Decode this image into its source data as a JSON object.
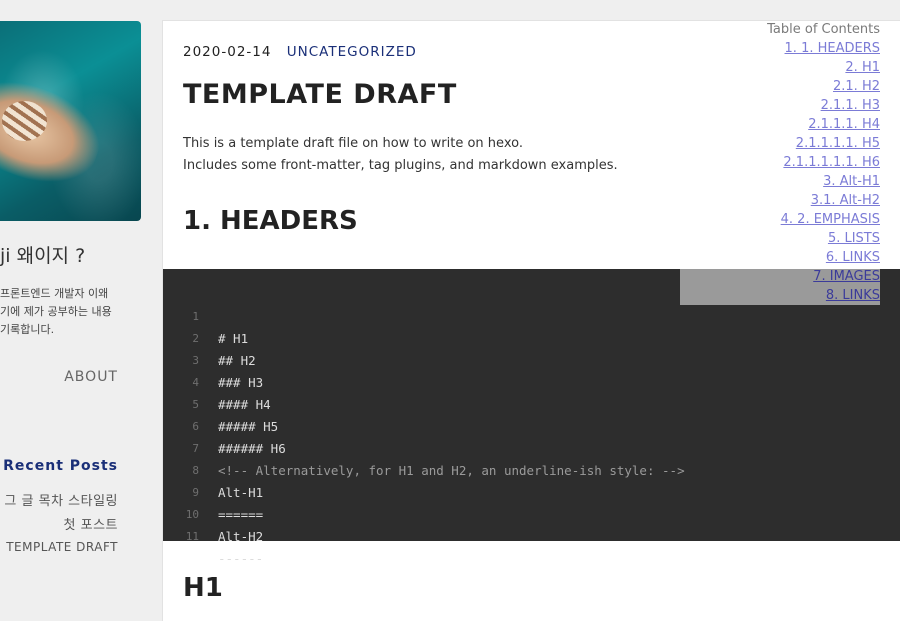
{
  "sidebar": {
    "site_title": "ji 왜이지 ?",
    "description": "프론트엔드 개발자 이왜 기에 제가 공부하는 내용 기록합니다.",
    "nav": {
      "about": "ABOUT"
    },
    "recent_posts": {
      "title": "Recent Posts",
      "items": [
        "그 글 목차 스타일링",
        "첫 포스트",
        "TEMPLATE DRAFT"
      ]
    }
  },
  "post": {
    "date": "2020-02-14",
    "category": "UNCATEGORIZED",
    "title": "TEMPLATE DRAFT",
    "intro_line1": "This is a template draft file on how to write on hexo.",
    "intro_line2": "Includes some front-matter, tag plugins, and markdown examples.",
    "headings": {
      "headers": "1. HEADERS",
      "h1": "H1"
    }
  },
  "code_block": {
    "lines": [
      {
        "num": "1",
        "text": "# H1"
      },
      {
        "num": "2",
        "text": "## H2"
      },
      {
        "num": "3",
        "text": "### H3"
      },
      {
        "num": "4",
        "text": "#### H4"
      },
      {
        "num": "5",
        "text": "##### H5"
      },
      {
        "num": "6",
        "text": "###### H6"
      },
      {
        "num": "7",
        "text": "<!-- Alternatively, for H1 and H2, an underline-ish style: -->"
      },
      {
        "num": "8",
        "text": "Alt-H1"
      },
      {
        "num": "9",
        "text": "======"
      },
      {
        "num": "10",
        "text": "Alt-H2"
      },
      {
        "num": "11",
        "text": "------"
      }
    ]
  },
  "toc": {
    "title": "Table of Contents",
    "items": [
      "1. 1. HEADERS",
      "2. H1",
      "2.1. H2",
      "2.1.1. H3",
      "2.1.1.1. H4",
      "2.1.1.1.1. H5",
      "2.1.1.1.1.1. H6",
      "3. Alt-H1",
      "3.1. Alt-H2",
      "4. 2. EMPHASIS",
      "5. LISTS",
      "6. LINKS",
      "7. IMAGES",
      "8. LINKS"
    ]
  },
  "colors": {
    "accent": "#1a2f78",
    "code_bg": "#2d2d2d",
    "toc_link": "#7b7bd6"
  }
}
